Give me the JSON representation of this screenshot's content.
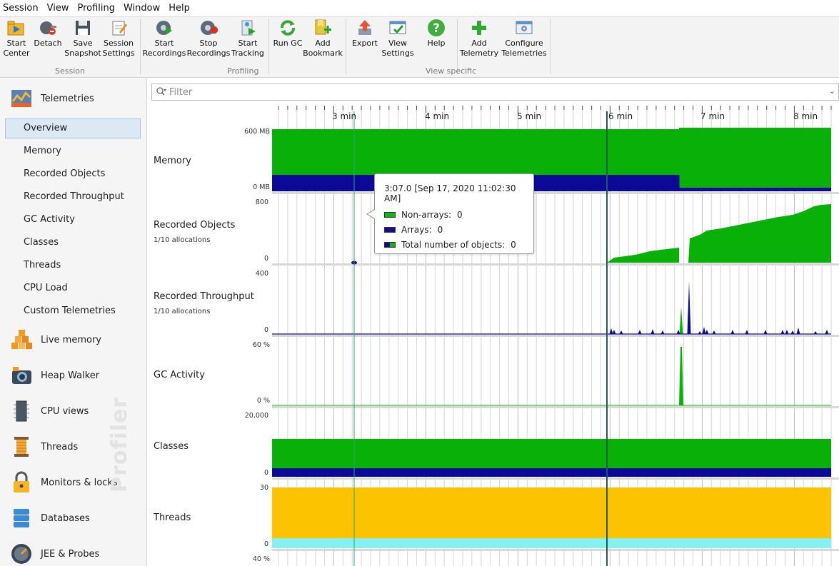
{
  "menu": [
    "Session",
    "View",
    "Profiling",
    "Window",
    "Help"
  ],
  "toolbar": {
    "buttons": [
      {
        "label": "Start\nCenter",
        "icon": "start-center-icon"
      },
      {
        "label": "Detach",
        "icon": "detach-icon"
      },
      {
        "label": "Save\nSnapshot",
        "icon": "save-snapshot-icon"
      },
      {
        "label": "Session\nSettings",
        "icon": "session-settings-icon"
      },
      {
        "label": "Start\nRecordings",
        "icon": "start-recordings-icon"
      },
      {
        "label": "Stop\nRecordings",
        "icon": "stop-recordings-icon"
      },
      {
        "label": "Start\nTracking",
        "icon": "start-tracking-icon"
      },
      {
        "label": "Run GC",
        "icon": "run-gc-icon"
      },
      {
        "label": "Add\nBookmark",
        "icon": "add-bookmark-icon"
      },
      {
        "label": "Export",
        "icon": "export-icon"
      },
      {
        "label": "View\nSettings",
        "icon": "view-settings-icon"
      },
      {
        "label": "Help",
        "icon": "help-icon"
      },
      {
        "label": "Add\nTelemetry",
        "icon": "add-telemetry-icon"
      },
      {
        "label": "Configure\nTelemetries",
        "icon": "configure-telemetries-icon"
      }
    ],
    "groups": [
      "Session",
      "Profiling",
      "View specific"
    ]
  },
  "sidebar": {
    "telemetries_label": "Telemetries",
    "items": [
      "Overview",
      "Memory",
      "Recorded Objects",
      "Recorded Throughput",
      "GC Activity",
      "Classes",
      "Threads",
      "CPU Load",
      "Custom Telemetries"
    ],
    "selected": "Overview",
    "sections": [
      {
        "label": "Live memory",
        "icon": "live-memory-icon"
      },
      {
        "label": "Heap Walker",
        "icon": "heap-walker-icon"
      },
      {
        "label": "CPU views",
        "icon": "cpu-views-icon"
      },
      {
        "label": "Threads",
        "icon": "threads-icon"
      },
      {
        "label": "Monitors & locks",
        "icon": "monitors-locks-icon"
      },
      {
        "label": "Databases",
        "icon": "databases-icon"
      },
      {
        "label": "JEE & Probes",
        "icon": "jee-probes-icon"
      }
    ],
    "watermark": "Profiler"
  },
  "filter": {
    "placeholder": "Filter"
  },
  "timeline": {
    "labels": [
      "3 min",
      "4 min",
      "5 min",
      "6 min",
      "7 min",
      "8 min"
    ]
  },
  "rows": [
    {
      "label": "Memory",
      "sub": "",
      "ymax": "600 MB",
      "ymin": "0 MB"
    },
    {
      "label": "Recorded Objects",
      "sub": "1/10 allocations",
      "ymax": "800",
      "ymin": "0"
    },
    {
      "label": "Recorded Throughput",
      "sub": "1/10 allocations",
      "ymax": "400",
      "ymin": "0"
    },
    {
      "label": "GC Activity",
      "sub": "",
      "ymax": "60 %",
      "ymin": "0 %"
    },
    {
      "label": "Classes",
      "sub": "",
      "ymax": "20,000",
      "ymin": "0"
    },
    {
      "label": "Threads",
      "sub": "",
      "ymax": "30",
      "ymin": "0"
    },
    {
      "label": "",
      "sub": "",
      "ymax": "40 %",
      "ymin": ""
    }
  ],
  "tooltip": {
    "title": "3:07.0 [Sep 17, 2020 11:02:30 AM]",
    "rows": [
      {
        "label": "Non-arrays:",
        "value": "0",
        "color": "#11b411"
      },
      {
        "label": "Arrays:",
        "value": "0",
        "color": "#0d0d9a"
      },
      {
        "label": "Total number of objects:",
        "value": "0",
        "color": "mixed"
      }
    ]
  },
  "colors": {
    "green": "#08b008",
    "navy": "#0a0a96",
    "yellow": "#fcc400",
    "cyan": "#86f0f0"
  }
}
